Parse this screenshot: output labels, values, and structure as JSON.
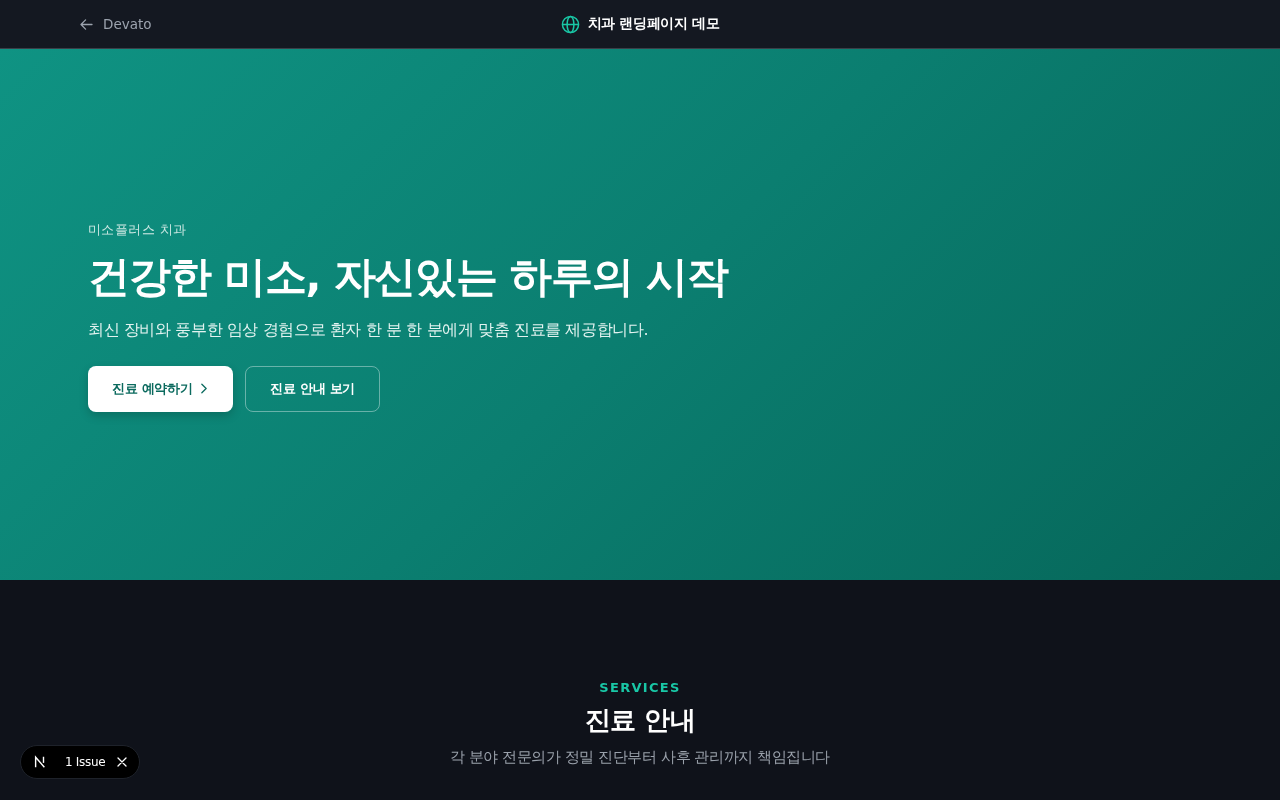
{
  "top_bar": {
    "back_link": "Devato",
    "title": "치과 랜딩페이지 데모"
  },
  "hero": {
    "eyebrow": "미소플러스 치과",
    "heading": "건강한 미소, 자신있는 하루의 시작",
    "subtitle": "최신 장비와 풍부한 임상 경험으로 환자 한 분 한 분에게 맞춤 진료를 제공합니다.",
    "buttons": [
      {
        "label": "진료 예약하기",
        "kind": "primary"
      },
      {
        "label": "진료 안내 보기",
        "kind": "outline"
      }
    ]
  },
  "services": {
    "eyebrow": "SERVICES",
    "heading": "진료 안내",
    "subtitle": "각 분야 전문의가 정밀 진단부터 사후 관리까지 책임집니다"
  },
  "dev_badge": {
    "label": "1 Issue"
  }
}
